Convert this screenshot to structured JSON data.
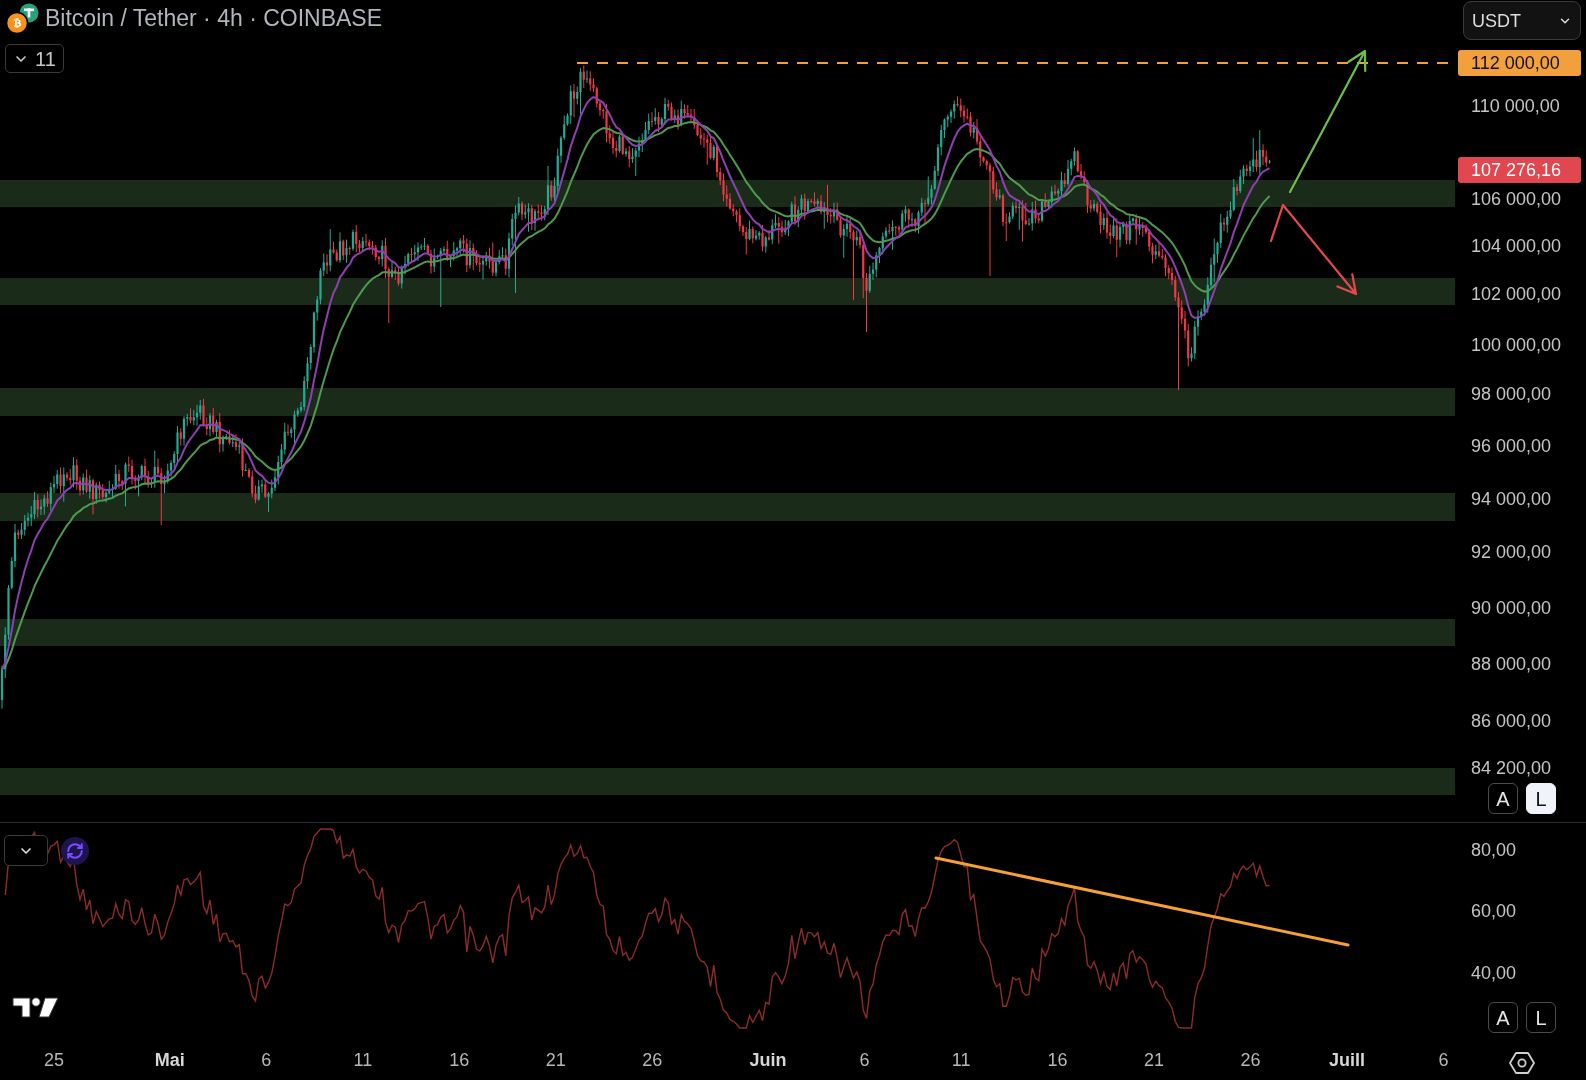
{
  "header": {
    "title": "Bitcoin / Tether · 4h · COINBASE",
    "indicator_toggle": {
      "count": "11"
    }
  },
  "currency_select": {
    "value": "USDT"
  },
  "price_axis": {
    "labels": [
      "110 000,00",
      "106 000,00",
      "104 000,00",
      "102 000,00",
      "100 000,00",
      "98 000,00",
      "96 000,00",
      "94 000,00",
      "92 000,00",
      "90 000,00",
      "88 000,00",
      "86 000,00",
      "84 200,00"
    ],
    "tags": [
      {
        "kind": "level",
        "label": "112 000,00",
        "color": "#f2a03d"
      },
      {
        "kind": "last_price",
        "label": "107 276,16",
        "color": "#e0474f"
      }
    ],
    "scale_buttons": [
      {
        "label": "A",
        "selected": false
      },
      {
        "label": "L",
        "selected": true
      }
    ]
  },
  "rsi_axis": {
    "labels": [
      "80,00",
      "60,00",
      "40,00"
    ],
    "scale_buttons": [
      {
        "label": "A",
        "selected": false
      },
      {
        "label": "L",
        "selected": false
      }
    ]
  },
  "time_axis": {
    "labels": [
      {
        "text": "25",
        "kind": "day"
      },
      {
        "text": "Mai",
        "kind": "month"
      },
      {
        "text": "6",
        "kind": "day"
      },
      {
        "text": "11",
        "kind": "day"
      },
      {
        "text": "16",
        "kind": "day"
      },
      {
        "text": "21",
        "kind": "day"
      },
      {
        "text": "26",
        "kind": "day"
      },
      {
        "text": "Juin",
        "kind": "month"
      },
      {
        "text": "6",
        "kind": "day"
      },
      {
        "text": "11",
        "kind": "day"
      },
      {
        "text": "16",
        "kind": "day"
      },
      {
        "text": "21",
        "kind": "day"
      },
      {
        "text": "26",
        "kind": "day"
      },
      {
        "text": "Juill",
        "kind": "month"
      },
      {
        "text": "6",
        "kind": "day"
      }
    ]
  }
}
